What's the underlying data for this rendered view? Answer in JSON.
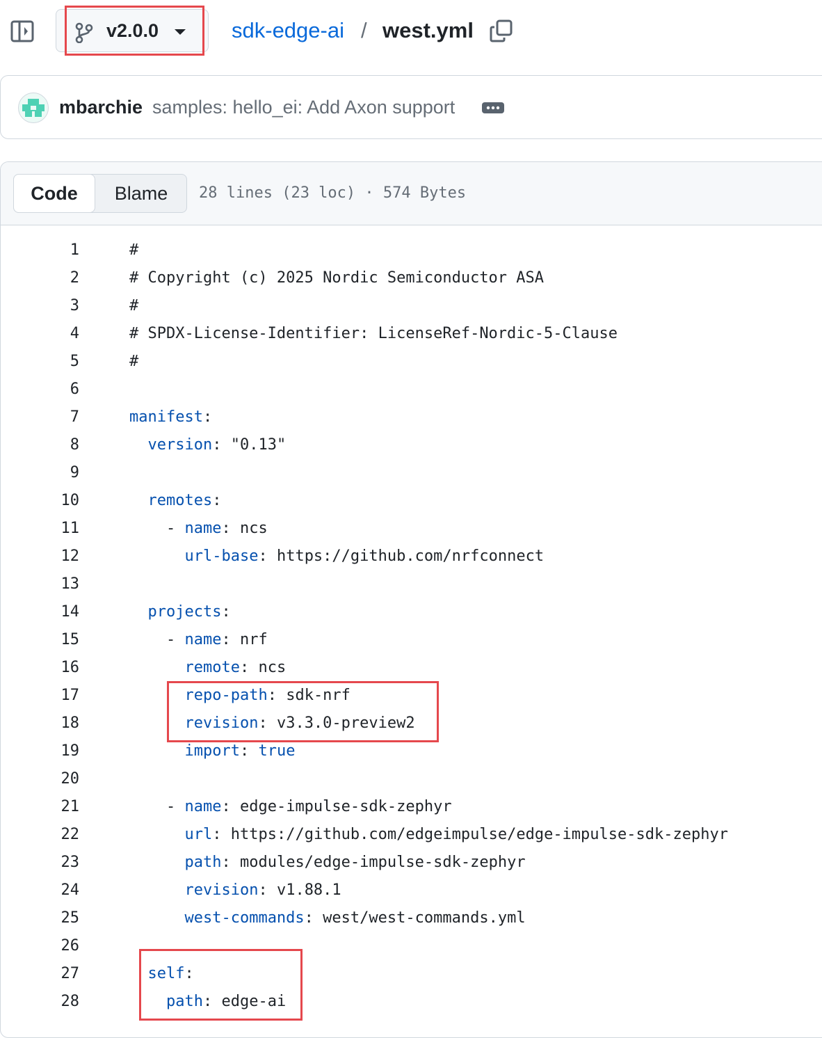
{
  "header": {
    "panel_icon": "sidebar-expand-icon",
    "branch_icon": "git-branch-icon",
    "branch": "v2.0.0",
    "repo": "sdk-edge-ai",
    "separator": "/",
    "file": "west.yml",
    "copy_icon": "copy-icon"
  },
  "commit": {
    "author": "mbarchie",
    "message": "samples: hello_ei: Add Axon support",
    "more_icon": "ellipsis-icon"
  },
  "file_view": {
    "tabs": [
      "Code",
      "Blame"
    ],
    "active_tab": "Code",
    "info": "28 lines (23 loc) · 574 Bytes"
  },
  "code_lines": [
    {
      "n": "1",
      "indent": "",
      "key": "",
      "sep": "",
      "val": "#"
    },
    {
      "n": "2",
      "indent": "",
      "key": "",
      "sep": "",
      "val": "# Copyright (c) 2025 Nordic Semiconductor ASA"
    },
    {
      "n": "3",
      "indent": "",
      "key": "",
      "sep": "",
      "val": "#"
    },
    {
      "n": "4",
      "indent": "",
      "key": "",
      "sep": "",
      "val": "# SPDX-License-Identifier: LicenseRef-Nordic-5-Clause"
    },
    {
      "n": "5",
      "indent": "",
      "key": "",
      "sep": "",
      "val": "#"
    },
    {
      "n": "6",
      "indent": "",
      "key": "",
      "sep": "",
      "val": ""
    },
    {
      "n": "7",
      "indent": "",
      "key": "manifest",
      "sep": ":",
      "val": ""
    },
    {
      "n": "8",
      "indent": "  ",
      "key": "version",
      "sep": ": ",
      "val": "\"0.13\""
    },
    {
      "n": "9",
      "indent": "",
      "key": "",
      "sep": "",
      "val": ""
    },
    {
      "n": "10",
      "indent": "  ",
      "key": "remotes",
      "sep": ":",
      "val": ""
    },
    {
      "n": "11",
      "indent": "    - ",
      "key": "name",
      "sep": ": ",
      "val": "ncs"
    },
    {
      "n": "12",
      "indent": "      ",
      "key": "url-base",
      "sep": ": ",
      "val": "https://github.com/nrfconnect"
    },
    {
      "n": "13",
      "indent": "",
      "key": "",
      "sep": "",
      "val": ""
    },
    {
      "n": "14",
      "indent": "  ",
      "key": "projects",
      "sep": ":",
      "val": ""
    },
    {
      "n": "15",
      "indent": "    - ",
      "key": "name",
      "sep": ": ",
      "val": "nrf"
    },
    {
      "n": "16",
      "indent": "      ",
      "key": "remote",
      "sep": ": ",
      "val": "ncs"
    },
    {
      "n": "17",
      "indent": "      ",
      "key": "repo-path",
      "sep": ": ",
      "val": "sdk-nrf"
    },
    {
      "n": "18",
      "indent": "      ",
      "key": "revision",
      "sep": ": ",
      "val": "v3.3.0-preview2"
    },
    {
      "n": "19",
      "indent": "      ",
      "key": "import",
      "sep": ": ",
      "val": "true",
      "val_kw": true
    },
    {
      "n": "20",
      "indent": "",
      "key": "",
      "sep": "",
      "val": ""
    },
    {
      "n": "21",
      "indent": "    - ",
      "key": "name",
      "sep": ": ",
      "val": "edge-impulse-sdk-zephyr"
    },
    {
      "n": "22",
      "indent": "      ",
      "key": "url",
      "sep": ": ",
      "val": "https://github.com/edgeimpulse/edge-impulse-sdk-zephyr"
    },
    {
      "n": "23",
      "indent": "      ",
      "key": "path",
      "sep": ": ",
      "val": "modules/edge-impulse-sdk-zephyr"
    },
    {
      "n": "24",
      "indent": "      ",
      "key": "revision",
      "sep": ": ",
      "val": "v1.88.1"
    },
    {
      "n": "25",
      "indent": "      ",
      "key": "west-commands",
      "sep": ": ",
      "val": "west/west-commands.yml"
    },
    {
      "n": "26",
      "indent": "",
      "key": "",
      "sep": "",
      "val": ""
    },
    {
      "n": "27",
      "indent": "  ",
      "key": "self",
      "sep": ":",
      "val": ""
    },
    {
      "n": "28",
      "indent": "    ",
      "key": "path",
      "sep": ": ",
      "val": "edge-ai"
    }
  ],
  "colors": {
    "link": "#0969da",
    "yaml_key": "#0550ae",
    "highlight_box": "#e5484d",
    "muted_text": "#656d76"
  }
}
